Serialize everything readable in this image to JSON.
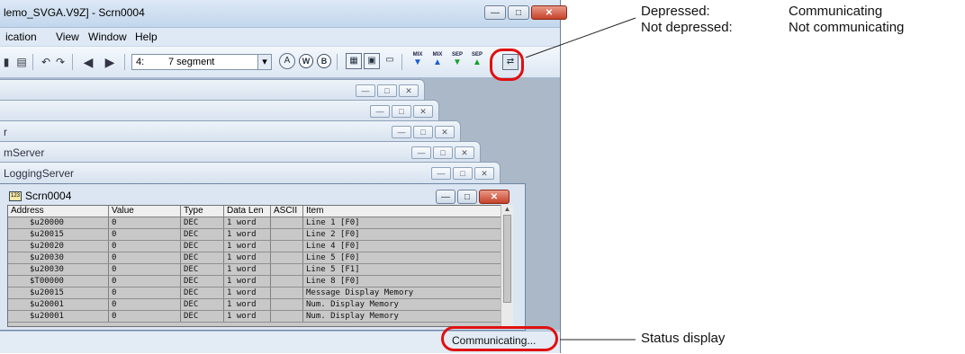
{
  "window": {
    "title": "lemo_SVGA.V9Z] - Scrn0004",
    "min": "—",
    "max": "□",
    "close": "✕"
  },
  "menu": {
    "items": [
      "ication",
      "View",
      "Window",
      "Help"
    ]
  },
  "toolbar": {
    "screen_no": "4:",
    "screen_name": "7 segment",
    "combo_arrow": "▾",
    "bit_labels": [
      "MIX",
      "MIX",
      "SEP",
      "SEP"
    ]
  },
  "child_windows": [
    {
      "title": ""
    },
    {
      "title": ""
    },
    {
      "title": "r"
    },
    {
      "title": "mServer"
    },
    {
      "title": "LoggingServer"
    }
  ],
  "scrn": {
    "title": "Scrn0004"
  },
  "table": {
    "headers": [
      "Address",
      "Value",
      "Type",
      "Data Len",
      "ASCII",
      "Item"
    ],
    "rows": [
      [
        "$u20000",
        "0",
        "DEC",
        "1 word",
        "",
        "Line 1 [F0]"
      ],
      [
        "$u20015",
        "0",
        "DEC",
        "1 word",
        "",
        "Line 2 [F0]"
      ],
      [
        "$u20020",
        "0",
        "DEC",
        "1 word",
        "",
        "Line 4 [F0]"
      ],
      [
        "$u20030",
        "0",
        "DEC",
        "1 word",
        "",
        "Line 5 [F0]"
      ],
      [
        "$u20030",
        "0",
        "DEC",
        "1 word",
        "",
        "Line 5 [F1]"
      ],
      [
        "$T00000",
        "0",
        "DEC",
        "1 word",
        "",
        "Line 8 [F0]"
      ],
      [
        "$u20015",
        "0",
        "DEC",
        "1 word",
        "",
        "Message Display Memory"
      ],
      [
        "$u20001",
        "0",
        "DEC",
        "1 word",
        "",
        "Num. Display Memory"
      ],
      [
        "$u20001",
        "0",
        "DEC",
        "1 word",
        "",
        "Num. Display Memory"
      ]
    ]
  },
  "status": {
    "text": "Communicating..."
  },
  "callouts": {
    "depressed_label": "Depressed:",
    "depressed_value": "Communicating",
    "not_depressed_label": "Not depressed:",
    "not_depressed_value": "Not communicating",
    "status_display": "Status display"
  },
  "colors": {
    "highlight": "#e01010",
    "title_bg": "#c2d6ec"
  }
}
